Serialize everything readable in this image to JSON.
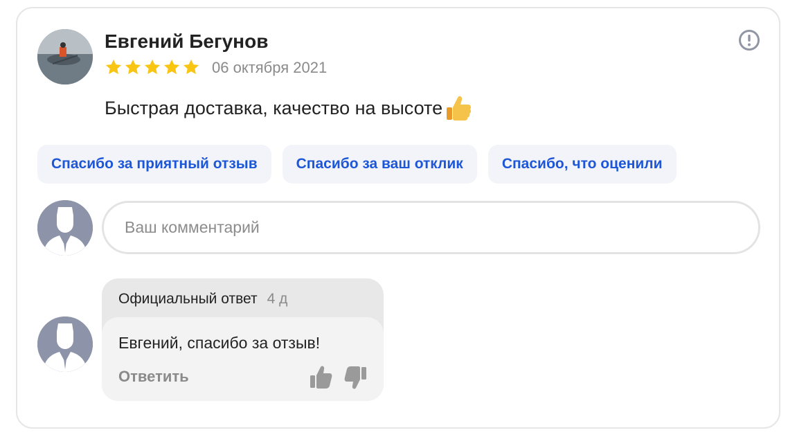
{
  "review": {
    "author_name": "Евгений Бегунов",
    "rating": 5,
    "date": "06 октября 2021",
    "text": "Быстрая доставка, качество на высоте",
    "text_emoji_icon": "thumbs-up-emoji"
  },
  "quick_replies": [
    "Спасибо за приятный отзыв",
    "Спасибо за ваш отклик",
    "Спасибо, что оценили"
  ],
  "comment": {
    "placeholder": "Ваш комментарий",
    "value": ""
  },
  "official_answer": {
    "label": "Официальный ответ",
    "age": "4 д",
    "text": "Евгений, спасибо за отзыв!",
    "reply_label": "Ответить"
  },
  "icons": {
    "report": "exclamation-circle-icon",
    "like": "thumbs-up-icon",
    "dislike": "thumbs-down-icon",
    "star": "star-icon",
    "user_placeholder": "user-silhouette-icon"
  },
  "colors": {
    "star": "#f8c512",
    "link_blue": "#1d56d6",
    "chip_bg": "#f2f4f9",
    "muted": "#8a8a8a",
    "avatar_placeholder": "#8d93a8"
  }
}
